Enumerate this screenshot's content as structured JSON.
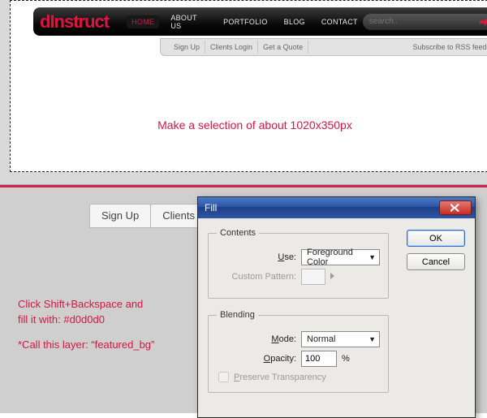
{
  "top": {
    "logo": "dInstruct",
    "menu": [
      "HOME",
      "ABOUT US",
      "PORTFOLIO",
      "BLOG",
      "CONTACT"
    ],
    "active_index": 0,
    "search_placeholder": "search..",
    "subbar": [
      "Sign Up",
      "Clients Login",
      "Get a Quote"
    ],
    "rss": "Subscribe to RSS feeds",
    "instruction": "Make a selection of about 1020x350px"
  },
  "bottom": {
    "tabs": [
      "Sign Up",
      "Clients Logi"
    ],
    "annot_line1": "Click Shift+Backspace and",
    "annot_line2": "fill it with: #d0d0d0",
    "annot_line3": "*Call this layer: “featured_bg”"
  },
  "dialog": {
    "title": "Fill",
    "ok": "OK",
    "cancel": "Cancel",
    "contents_legend": "Contents",
    "use_label": "Use:",
    "use_value": "Foreground Color",
    "pattern_label": "Custom Pattern:",
    "blending_legend": "Blending",
    "mode_label": "Mode:",
    "mode_value": "Normal",
    "opacity_label": "Opacity:",
    "opacity_value": "100",
    "opacity_unit": "%",
    "preserve": "Preserve Transparency"
  }
}
